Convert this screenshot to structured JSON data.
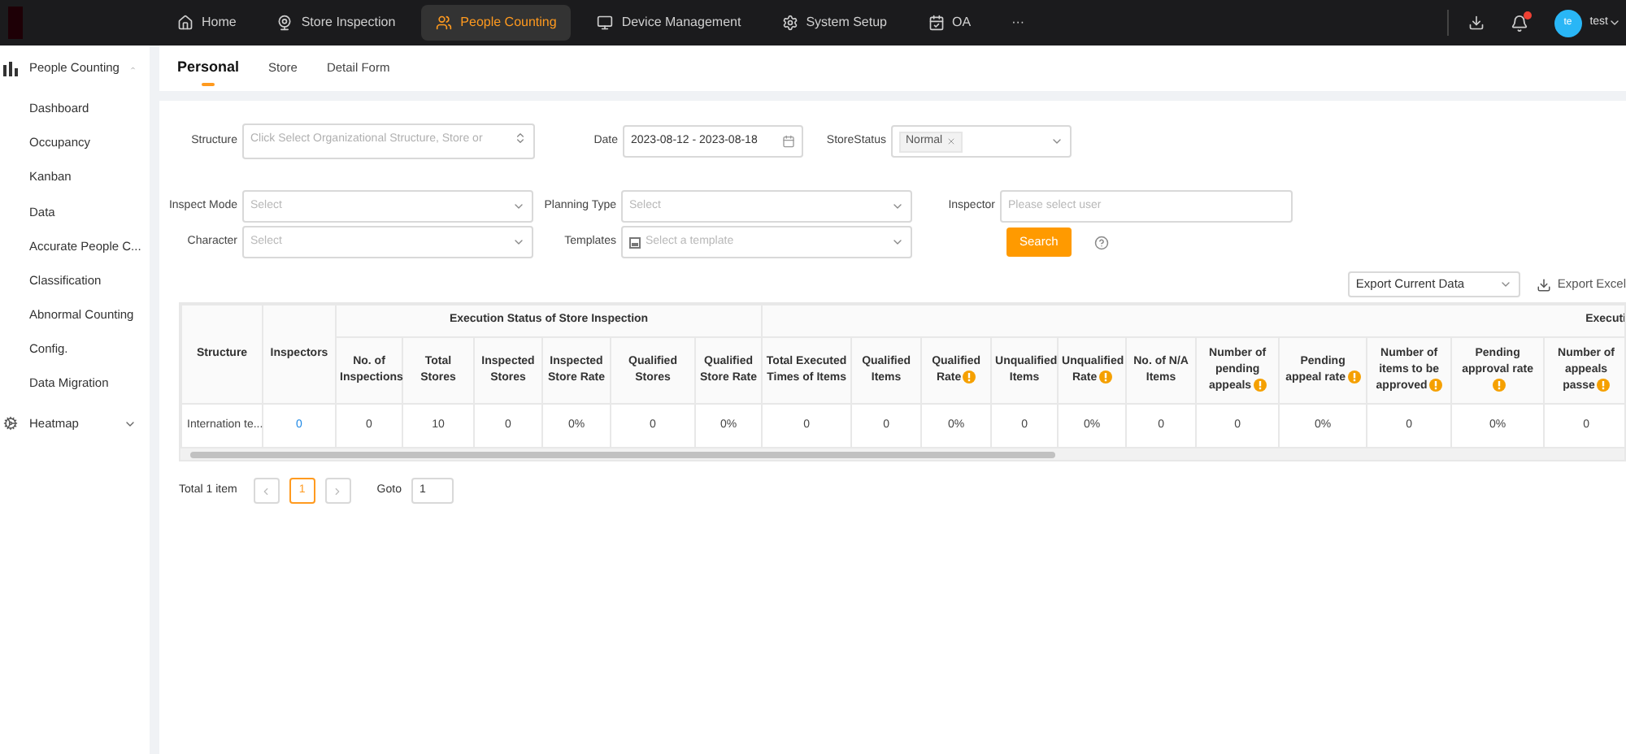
{
  "top_nav": {
    "items": [
      {
        "label": "Home",
        "selected": false
      },
      {
        "label": "Store Inspection",
        "selected": false
      },
      {
        "label": "People Counting",
        "selected": true
      },
      {
        "label": "Device Management",
        "selected": false
      },
      {
        "label": "System Setup",
        "selected": false
      },
      {
        "label": "OA",
        "selected": false
      },
      {
        "label": "···",
        "selected": false
      }
    ],
    "user": {
      "initials": "te",
      "name": "test"
    }
  },
  "sidebar": {
    "items": [
      {
        "label": "People Counting",
        "expanded": true,
        "children": [
          {
            "label": "Dashboard"
          },
          {
            "label": "Occupancy"
          },
          {
            "label": "Kanban"
          },
          {
            "label": "Data"
          },
          {
            "label": "Accurate People C..."
          },
          {
            "label": "Classification"
          },
          {
            "label": "Abnormal Counting"
          },
          {
            "label": "Config."
          },
          {
            "label": "Data Migration"
          }
        ]
      },
      {
        "label": "Heatmap",
        "expanded": false
      }
    ]
  },
  "tabs": [
    {
      "label": "Personal",
      "selected": true
    },
    {
      "label": "Store",
      "selected": false
    },
    {
      "label": "Detail Form",
      "selected": false
    }
  ],
  "filters": [
    [
      {
        "label": "Structure",
        "kind": "textarea",
        "placeholder": "Click Select Organizational Structure, Store or"
      },
      {
        "label": "Date",
        "kind": "date",
        "value": "2023-08-12 - 2023-08-18"
      },
      {
        "label": "StoreStatus",
        "kind": "tags",
        "tags": [
          "Normal"
        ]
      }
    ],
    [
      {
        "label": "Inspect Mode",
        "kind": "select",
        "placeholder": "Select"
      },
      {
        "label": "Planning Type",
        "kind": "select",
        "placeholder": "Select"
      },
      {
        "label": "Inspector",
        "kind": "input",
        "placeholder": "Please select user"
      }
    ],
    [
      {
        "label": "Character",
        "kind": "select",
        "placeholder": "Select"
      },
      {
        "label": "Templates",
        "kind": "template",
        "placeholder": "Select a template"
      }
    ]
  ],
  "search_button": "Search",
  "export": {
    "select": "Export Current Data",
    "button": "Export Excel"
  },
  "table": {
    "fixed_columns": [
      {
        "label": "Structure"
      },
      {
        "label": "Inspectors"
      }
    ],
    "groups": [
      {
        "label": "Execution Status of Store Inspection",
        "columns": [
          {
            "label": "No. of Inspections",
            "info": false
          },
          {
            "label": "Total Stores",
            "info": false
          },
          {
            "label": "Inspected Stores",
            "info": false
          },
          {
            "label": "Inspected Store Rate",
            "info": false
          },
          {
            "label": "Qualified Stores",
            "info": false
          },
          {
            "label": "Qualified Store Rate",
            "info": false
          }
        ]
      },
      {
        "label": "Executi",
        "columns": [
          {
            "label": "Total Executed Times of Items",
            "info": false
          },
          {
            "label": "Qualified Items",
            "info": false
          },
          {
            "label": "Qualified Rate",
            "info": true
          },
          {
            "label": "Unqualified Items",
            "info": false
          },
          {
            "label": "Unqualified Rate",
            "info": true
          },
          {
            "label": "No. of N/A Items",
            "info": false
          },
          {
            "label": "Number of pending appeals",
            "info": true
          },
          {
            "label": "Pending appeal rate",
            "info": true
          },
          {
            "label": "Number of items to be approved",
            "info": true
          },
          {
            "label": "Pending approval rate",
            "info": true
          },
          {
            "label": "Number of appeals passe",
            "info": true
          }
        ]
      }
    ],
    "rows": [
      {
        "cells": [
          {
            "text": "Internation te...",
            "link": false
          },
          {
            "text": "0",
            "link": true
          },
          {
            "text": "0",
            "link": false
          },
          {
            "text": "10",
            "link": false
          },
          {
            "text": "0",
            "link": false
          },
          {
            "text": "0%",
            "link": false
          },
          {
            "text": "0",
            "link": false
          },
          {
            "text": "0%",
            "link": false
          },
          {
            "text": "0",
            "link": false
          },
          {
            "text": "0",
            "link": false
          },
          {
            "text": "0%",
            "link": false
          },
          {
            "text": "0",
            "link": false
          },
          {
            "text": "0%",
            "link": false
          },
          {
            "text": "0",
            "link": false
          },
          {
            "text": "0",
            "link": false
          },
          {
            "text": "0%",
            "link": false
          },
          {
            "text": "0",
            "link": false
          },
          {
            "text": "0%",
            "link": false
          },
          {
            "text": "0",
            "link": false
          }
        ]
      }
    ]
  },
  "pagination": {
    "total": "Total 1 item",
    "pages": [
      {
        "label": "1",
        "selected": true
      }
    ],
    "goto_label": "Goto",
    "goto_value": "1"
  }
}
